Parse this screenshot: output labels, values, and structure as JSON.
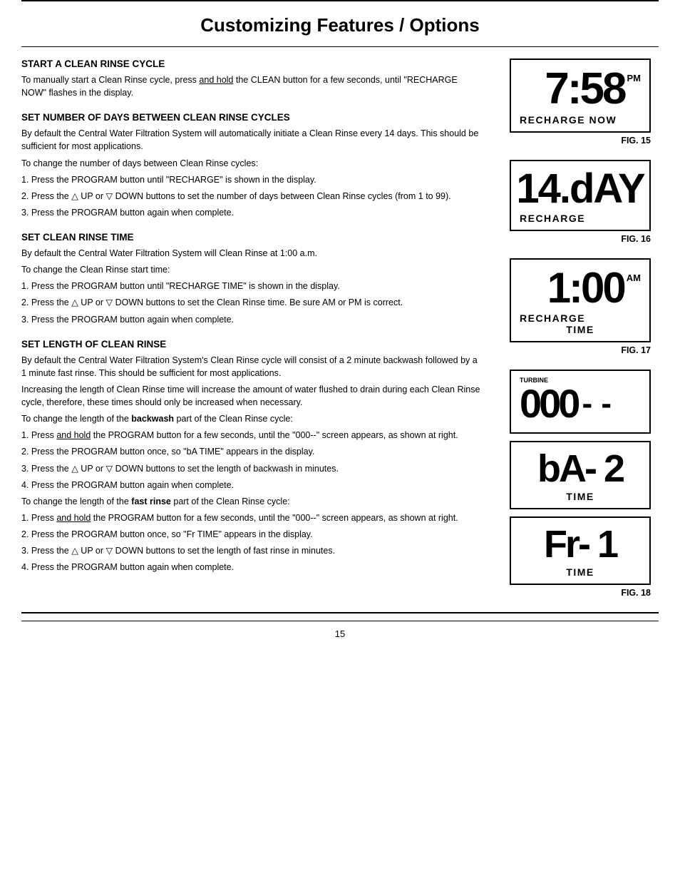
{
  "page": {
    "title": "Customizing Features / Options",
    "page_number": "15"
  },
  "sections": [
    {
      "id": "start-clean-rinse",
      "title": "START A CLEAN RINSE CYCLE",
      "paragraphs": [
        "To manually start a Clean Rinse cycle, press and hold the CLEAN button for a few seconds, until \"RECHARGE NOW\" flashes in the display."
      ]
    },
    {
      "id": "set-days",
      "title": "SET NUMBER OF DAYS BETWEEN CLEAN RINSE CYCLES",
      "paragraphs": [
        "By default the Central Water Filtration System will automatically initiate a Clean Rinse every 14 days.  This should be sufficient for most applications.",
        "To change the number of days between Clean Rinse cycles:",
        "1. Press the PROGRAM button until \"RECHARGE\" is shown in the display.",
        "2. Press the △ UP or ▽ DOWN buttons to set the number of days between Clean Rinse cycles (from 1 to 99).",
        "3. Press the PROGRAM button again when complete."
      ]
    },
    {
      "id": "set-clean-rinse-time",
      "title": "SET CLEAN RINSE TIME",
      "paragraphs": [
        "By default the Central Water Filtration System will Clean Rinse at 1:00 a.m.",
        "To change the Clean Rinse start time:",
        "1. Press the PROGRAM button until \"RECHARGE TIME\" is shown in the display.",
        "2. Press the △ UP or ▽ DOWN buttons to set the Clean Rinse time.  Be sure AM or PM is correct.",
        "3. Press the PROGRAM button again when complete."
      ]
    },
    {
      "id": "set-length",
      "title": "SET LENGTH OF CLEAN RINSE",
      "paragraphs": [
        "By default the Central Water Filtration System's Clean Rinse cycle will consist of a 2 minute backwash followed by a 1 minute fast rinse.  This should be sufficient for most applications.",
        "Increasing the length of Clean Rinse time will increase the amount of water flushed to drain during each Clean Rinse cycle, therefore, these times should only be increased when necessary.",
        "To change the length of the backwash part of the Clean Rinse cycle:",
        "1. Press and hold the PROGRAM button for a few seconds, until the \"000--\" screen appears, as shown at right.",
        "2. Press the PROGRAM button once, so \"bA TIME\" appears in the display.",
        "3. Press the △ UP or ▽ DOWN buttons to set the length of backwash in minutes.",
        "4. Press the PROGRAM button again when complete.",
        "To change the length of the fast rinse part of the Clean Rinse cycle:",
        "1. Press and hold the PROGRAM button for a few seconds, until the \"000--\" screen appears, as shown at right.",
        "2. Press the PROGRAM button once, so \"Fr TIME\" appears in the display.",
        "3. Press the △ UP or ▽ DOWN buttons to set the length of fast rinse in minutes.",
        "4. Press the PROGRAM button again when complete."
      ]
    }
  ],
  "figures": [
    {
      "id": "fig15",
      "label": "FIG. 15",
      "display_top": "7:58",
      "display_ampm": "PM",
      "display_bottom": "RECHARGE  NOW"
    },
    {
      "id": "fig16",
      "label": "FIG. 16",
      "display_top": "14.dAY",
      "display_bottom": "RECHARGE"
    },
    {
      "id": "fig17",
      "label": "FIG. 17",
      "display_top": "1:00",
      "display_ampm": "AM",
      "display_bottom_line1": "RECHARGE",
      "display_bottom_line2": "TIME"
    },
    {
      "id": "fig18a",
      "label": "",
      "display_top": "000 --",
      "display_label": "TURBINE"
    },
    {
      "id": "fig18b",
      "label": "",
      "display_top": "bA-  2",
      "display_bottom": "TIME"
    },
    {
      "id": "fig18c",
      "label": "FIG. 18",
      "display_top": "Fr-  1",
      "display_bottom": "TIME"
    }
  ]
}
